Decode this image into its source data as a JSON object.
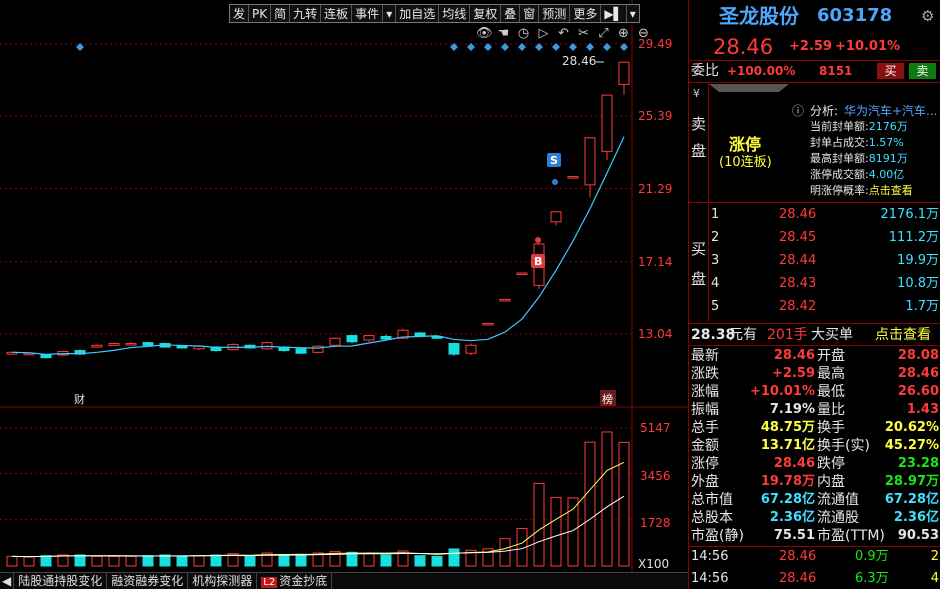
{
  "toolbar": {
    "items": [
      "发",
      "PK",
      "简",
      "九转",
      "连板",
      "事件",
      "▾",
      "加自选",
      "均线",
      "复权",
      "叠",
      "窗",
      "预测",
      "更多",
      "▶▌",
      "▾"
    ]
  },
  "chart": {
    "price_labels": [
      "29.49",
      "25.39",
      "21.29",
      "17.14",
      "13.04"
    ],
    "last_price_label": "28.46",
    "marker_s": "S",
    "marker_b": "B",
    "tag_cai": "财",
    "tag_bang": "榜",
    "volume_labels": [
      "5147",
      "3456",
      "1728"
    ],
    "volume_unit": "X100"
  },
  "chart_data": {
    "type": "candlestick",
    "price_axis": [
      13.04,
      17.14,
      21.29,
      25.39,
      29.49
    ],
    "candles": [
      {
        "o": 11.9,
        "c": 12.0,
        "h": 12.05,
        "l": 11.85
      },
      {
        "o": 11.9,
        "c": 11.95,
        "h": 12.0,
        "l": 11.85
      },
      {
        "o": 11.85,
        "c": 11.7,
        "h": 11.9,
        "l": 11.65
      },
      {
        "o": 11.85,
        "c": 12.05,
        "h": 12.1,
        "l": 11.8
      },
      {
        "o": 12.1,
        "c": 11.9,
        "h": 12.15,
        "l": 11.85
      },
      {
        "o": 12.3,
        "c": 12.4,
        "h": 12.45,
        "l": 12.25
      },
      {
        "o": 12.4,
        "c": 12.5,
        "h": 12.55,
        "l": 12.35
      },
      {
        "o": 12.45,
        "c": 12.5,
        "h": 12.6,
        "l": 12.4
      },
      {
        "o": 12.55,
        "c": 12.4,
        "h": 12.6,
        "l": 12.35
      },
      {
        "o": 12.5,
        "c": 12.3,
        "h": 12.55,
        "l": 12.25
      },
      {
        "o": 12.35,
        "c": 12.25,
        "h": 12.4,
        "l": 12.2
      },
      {
        "o": 12.2,
        "c": 12.35,
        "h": 12.4,
        "l": 12.15
      },
      {
        "o": 12.3,
        "c": 12.1,
        "h": 12.35,
        "l": 12.05
      },
      {
        "o": 12.15,
        "c": 12.45,
        "h": 12.5,
        "l": 12.1
      },
      {
        "o": 12.4,
        "c": 12.25,
        "h": 12.45,
        "l": 12.2
      },
      {
        "o": 12.2,
        "c": 12.55,
        "h": 12.6,
        "l": 12.15
      },
      {
        "o": 12.3,
        "c": 12.1,
        "h": 12.35,
        "l": 12.05
      },
      {
        "o": 12.2,
        "c": 11.95,
        "h": 12.25,
        "l": 11.9
      },
      {
        "o": 12.0,
        "c": 12.35,
        "h": 12.4,
        "l": 11.95
      },
      {
        "o": 12.4,
        "c": 12.8,
        "h": 12.85,
        "l": 12.3
      },
      {
        "o": 12.95,
        "c": 12.6,
        "h": 13.0,
        "l": 12.5
      },
      {
        "o": 12.7,
        "c": 12.95,
        "h": 13.0,
        "l": 12.6
      },
      {
        "o": 12.9,
        "c": 12.75,
        "h": 13.0,
        "l": 12.7
      },
      {
        "o": 12.8,
        "c": 13.25,
        "h": 13.35,
        "l": 12.75
      },
      {
        "o": 13.1,
        "c": 12.95,
        "h": 13.15,
        "l": 12.9
      },
      {
        "o": 12.9,
        "c": 12.8,
        "h": 12.95,
        "l": 12.75
      },
      {
        "o": 12.5,
        "c": 11.9,
        "h": 12.55,
        "l": 11.8
      },
      {
        "o": 11.95,
        "c": 12.4,
        "h": 12.5,
        "l": 11.85
      },
      {
        "o": 13.64,
        "c": 13.64,
        "h": 13.64,
        "l": 13.64
      },
      {
        "o": 15.0,
        "c": 15.0,
        "h": 15.0,
        "l": 15.0
      },
      {
        "o": 16.5,
        "c": 16.5,
        "h": 16.5,
        "l": 16.5
      },
      {
        "o": 15.8,
        "c": 18.15,
        "h": 18.2,
        "l": 15.6
      },
      {
        "o": 19.4,
        "c": 19.97,
        "h": 20.0,
        "l": 19.2
      },
      {
        "o": 21.97,
        "c": 21.97,
        "h": 21.97,
        "l": 21.97
      },
      {
        "o": 21.5,
        "c": 24.17,
        "h": 24.2,
        "l": 20.8
      },
      {
        "o": 23.4,
        "c": 26.59,
        "h": 26.6,
        "l": 22.9
      },
      {
        "o": 27.2,
        "c": 28.46,
        "h": 28.46,
        "l": 26.6
      }
    ],
    "volume_axis": [
      1728,
      3456,
      5147
    ],
    "volume_colors": [
      "#19e0e0",
      "#ff3a3a"
    ],
    "ma_color": "#40c8ff",
    "volume_ma_colors": [
      "#ffff60",
      "#ffffff"
    ]
  },
  "bottom_tabs": [
    "陆股通持股变化",
    "融资融券变化",
    "机构探测器",
    "资金抄底"
  ],
  "bottom_tab_badge": "L2",
  "panel": {
    "name": "圣龙股份",
    "code": "603178",
    "price": "28.46",
    "change": "+2.59",
    "change_pct": "+10.01%",
    "weibi_label": "委比",
    "weibi_value": "+100.00%",
    "weibi_num": "8151",
    "buy_btn": "买",
    "sell_btn": "卖",
    "sell_side_label": "卖盘",
    "limit_up": "涨停",
    "limit_boards": "(10连板)",
    "analysis_label": "分析:",
    "analysis_text": "华为汽车+汽车...",
    "seal_rows": [
      {
        "label": "当前封单额:",
        "value": "2176万"
      },
      {
        "label": "封单占成交:",
        "value": "1.57%"
      },
      {
        "label": "最高封单额:",
        "value": "8191万"
      },
      {
        "label": "涨停成交额:",
        "value": "4.00亿"
      },
      {
        "label": "明涨停概率:",
        "value": "点击查看"
      }
    ],
    "buy_side_label": "买盘",
    "buy_book": [
      {
        "level": "1",
        "price": "28.46",
        "volume": "2176.1万"
      },
      {
        "level": "2",
        "price": "28.45",
        "volume": "111.2万"
      },
      {
        "level": "3",
        "price": "28.44",
        "volume": "19.9万"
      },
      {
        "level": "4",
        "price": "28.43",
        "volume": "10.8万"
      },
      {
        "level": "5",
        "price": "28.42",
        "volume": "1.7万"
      }
    ],
    "big_order": {
      "price": "28.38",
      "unit": "元有",
      "lots": "201手",
      "kind": "大买单",
      "link": "点击查看"
    },
    "stats": [
      {
        "l1": "最新",
        "v1": "28.46",
        "c1": "red",
        "l2": "开盘",
        "v2": "28.08",
        "c2": "red"
      },
      {
        "l1": "涨跌",
        "v1": "+2.59",
        "c1": "red",
        "l2": "最高",
        "v2": "28.46",
        "c2": "red"
      },
      {
        "l1": "涨幅",
        "v1": "+10.01%",
        "c1": "red",
        "l2": "最低",
        "v2": "26.60",
        "c2": "red"
      },
      {
        "l1": "振幅",
        "v1": "7.19%",
        "c1": "white",
        "l2": "量比",
        "v2": "1.43",
        "c2": "red"
      },
      {
        "l1": "总手",
        "v1": "48.75万",
        "c1": "yellow",
        "l2": "换手",
        "v2": "20.62%",
        "c2": "yellow"
      },
      {
        "l1": "金额",
        "v1": "13.71亿",
        "c1": "yellow",
        "l2": "换手(实)",
        "v2": "45.27%",
        "c2": "yellow"
      },
      {
        "l1": "涨停",
        "v1": "28.46",
        "c1": "red",
        "l2": "跌停",
        "v2": "23.28",
        "c2": "green"
      },
      {
        "l1": "外盘",
        "v1": "19.78万",
        "c1": "red",
        "l2": "内盘",
        "v2": "28.97万",
        "c2": "green"
      },
      {
        "l1": "总市值",
        "v1": "67.28亿",
        "c1": "cyan",
        "l2": "流通值",
        "v2": "67.28亿",
        "c2": "cyan"
      },
      {
        "l1": "总股本",
        "v1": "2.36亿",
        "c1": "cyan",
        "l2": "流通股",
        "v2": "2.36亿",
        "c2": "cyan"
      },
      {
        "l1": "市盈(静)",
        "v1": "75.51",
        "c1": "white",
        "l2": "市盈(TTM)",
        "v2": "90.53",
        "c2": "white"
      }
    ],
    "ticks": [
      {
        "time": "14:56",
        "price": "28.46",
        "vol": "0.9万",
        "n": "2"
      },
      {
        "time": "14:56",
        "price": "28.46",
        "vol": "6.3万",
        "n": "4"
      }
    ]
  }
}
